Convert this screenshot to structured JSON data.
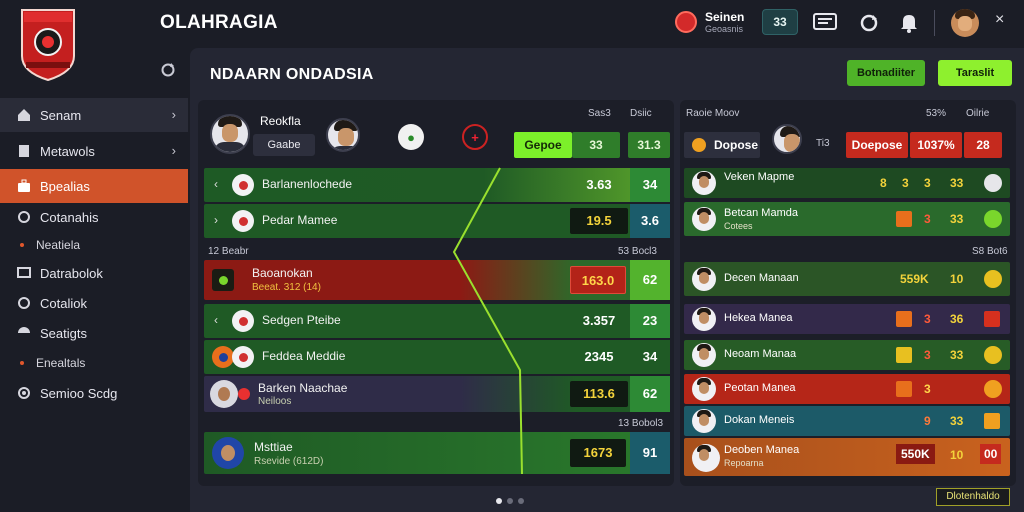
{
  "header": {
    "app_title": "OLAHRAGIA",
    "user": {
      "name": "Seinen",
      "sub": "Geoasnis"
    },
    "badge": "33",
    "icons": [
      "message-icon",
      "refresh-icon",
      "bell-icon"
    ],
    "close_label": "×"
  },
  "sidebar": {
    "items": [
      {
        "label": "Senam",
        "icon": "home-icon",
        "chevron": true
      },
      {
        "label": "Metawols",
        "icon": "bookmark-icon",
        "chevron": true
      },
      {
        "label": "Bpealias",
        "icon": "briefcase-icon",
        "active": true
      },
      {
        "label": "Cotanahis",
        "icon": "circle-icon"
      },
      {
        "label": "Neatiela",
        "sub": true
      },
      {
        "label": "Datrabolok",
        "icon": "monitor-icon"
      },
      {
        "label": "Cotaliok",
        "icon": "refresh-icon"
      },
      {
        "label": "Seatigts",
        "icon": "chart-icon"
      },
      {
        "label": "Enealtals",
        "sub": true
      },
      {
        "label": "Semioo Scdg",
        "icon": "sync-icon"
      }
    ]
  },
  "main": {
    "title": "NDAARN ONDADSIA",
    "button_a": "Botnadiiter",
    "button_b": "Taraslit"
  },
  "left": {
    "header": {
      "name": "Reokfla",
      "tag": "Gaabe",
      "col1": "Sas3",
      "col2": "Dsiic",
      "tab_label": "Gepoe",
      "tab_value": "33",
      "total": "31.3"
    },
    "rows_top": [
      {
        "arrow": "‹",
        "label": "Barlanenlochede",
        "v1": "3.63",
        "v2": "34"
      },
      {
        "arrow": "›",
        "label": "Pedar Mamee",
        "v1": "19.5",
        "v2": "3.6"
      }
    ],
    "section1": {
      "left": "12 Beabr",
      "right": "53 Bocl3"
    },
    "rows_mid": [
      {
        "label": "Baoanokan",
        "sub": "Beeat. 312 (14)",
        "v1": "163.0",
        "v2": "62"
      },
      {
        "arrow": "‹",
        "label": "Sedgen Pteibe",
        "v1": "3.357",
        "v2": "23"
      },
      {
        "label": "Feddea Meddie",
        "v1": "2345",
        "v2": "34"
      },
      {
        "label": "Barken Naachae",
        "sub": "Neiloos",
        "v1": "113.6",
        "v2": "62"
      }
    ],
    "section2": {
      "right": "13 Bobol3"
    },
    "row_bottom": {
      "label": "Msttiae",
      "sub": "Rsevide (612D)",
      "v1": "1673",
      "v2": "91"
    }
  },
  "right": {
    "header": {
      "title": "Raoie Moov",
      "col1": "53%",
      "col2": "Oilrie",
      "tag": "Dopose",
      "c1": "Ti3",
      "c2": "Doepose",
      "c3": "1037%",
      "c4": "28"
    },
    "rows": [
      {
        "name": "Veken Mapme",
        "vals": [
          "8",
          "3",
          "3",
          "33"
        ]
      },
      {
        "name": "Betcan Mamda",
        "sub": "Cotees",
        "vals": [
          "3",
          "33"
        ]
      },
      {
        "section": "S8 Bot6"
      },
      {
        "name": "Decen Manaan",
        "vals": [
          "559K",
          "10"
        ]
      },
      {
        "name": "Hekea Manea",
        "vals": [
          "3",
          "36"
        ]
      },
      {
        "name": "Neoam Manaa",
        "vals": [
          "3",
          "33"
        ]
      },
      {
        "name": "Peotan Manea",
        "vals": [
          "3"
        ]
      },
      {
        "name": "Dokan Meneis",
        "vals": [
          "9",
          "33"
        ]
      },
      {
        "name": "Deoben Manea",
        "sub": "Repoarna",
        "vals": [
          "550K",
          "10",
          "00"
        ]
      }
    ],
    "corner": "Dlotenhaldo"
  },
  "pager": {
    "pages": 3,
    "current": 1
  },
  "colors": {
    "accent": "#d0532a",
    "green": "#8ef02e",
    "red": "#c22a1e"
  }
}
